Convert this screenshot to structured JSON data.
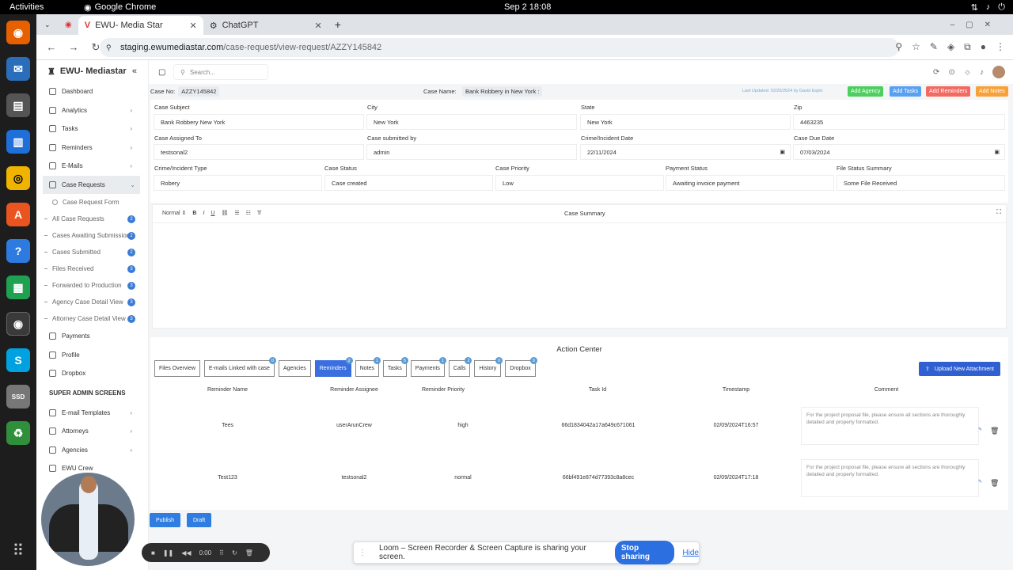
{
  "os": {
    "activities": "Activities",
    "app_name": "Google Chrome",
    "clock": "Sep 2  18:08"
  },
  "browser": {
    "tab1": "EWU- Media Star",
    "tab2": "ChatGPT",
    "url_host": "staging.ewumediastar.com",
    "url_path": "/case-request/view-request/AZZY145842"
  },
  "sidebar": {
    "brand": "EWU- Mediastar",
    "items": [
      "Dashboard",
      "Analytics",
      "Tasks",
      "Reminders",
      "E-Mails",
      "Case Requests"
    ],
    "form_item": "Case Request Form",
    "subs": [
      {
        "label": "All Case Requests",
        "count": "2"
      },
      {
        "label": "Cases Awaiting Submission",
        "count": "2"
      },
      {
        "label": "Cases Submitted",
        "count": "2"
      },
      {
        "label": "Files Received",
        "count": "3"
      },
      {
        "label": "Forwarded to Production",
        "count": "3"
      },
      {
        "label": "Agency Case Detail View",
        "count": "3"
      },
      {
        "label": "Attorney Case Detail View",
        "count": "3"
      }
    ],
    "items2": [
      "Payments",
      "Profile",
      "Dropbox"
    ],
    "section": "SUPER ADMIN SCREENS",
    "items3": [
      "E-mail Templates",
      "Attorneys",
      "Agencies",
      "EWU Crew"
    ]
  },
  "header": {
    "search_placeholder": "Search..."
  },
  "case": {
    "no_label": "Case No:",
    "no": "AZZY145842",
    "name_label": "Case Name:",
    "name": "Bank Robbery in New York :",
    "last_updated": "Last Updated: 02/25/2024 by David Espin"
  },
  "actions": {
    "add_agency": "Add Agency",
    "add_tasks": "Add Tasks",
    "add_reminders": "Add Reminders",
    "add_notes": "Add Notes"
  },
  "form": {
    "case_subject_label": "Case Subject",
    "case_subject": "Bank Robbery New York",
    "city_label": "City",
    "city": "New York",
    "state_label": "State",
    "state": "New York",
    "zip_label": "Zip",
    "zip": "4463235",
    "assigned_label": "Case Assigned To",
    "assigned": "testsonal2",
    "submitted_by_label": "Case submitted by",
    "submitted_by": "admin",
    "incident_date_label": "Crime/Incident Date",
    "incident_date": "22/11/2024",
    "due_date_label": "Case Due Date",
    "due_date": "07/03/2024",
    "incident_type_label": "Crime/Incident Type",
    "incident_type": "Robery",
    "status_label": "Case Status",
    "status": "Case created",
    "priority_label": "Case Priority",
    "priority": "Low",
    "payment_label": "Payment Status",
    "payment": "Awaiting invoice payment",
    "file_status_label": "File Status Summary",
    "file_status": "Some File Received"
  },
  "editor": {
    "format": "Normal",
    "title": "Case Summary"
  },
  "action_center": {
    "title": "Action Center",
    "upload": "Upload New Attachment",
    "tabs": [
      {
        "label": "Files Overview",
        "count": ""
      },
      {
        "label": "E-mails Linked with case",
        "count": "0"
      },
      {
        "label": "Agencies",
        "count": ""
      },
      {
        "label": "Reminders",
        "count": "2"
      },
      {
        "label": "Notes",
        "count": "1"
      },
      {
        "label": "Tasks",
        "count": "5"
      },
      {
        "label": "Payments",
        "count": "1"
      },
      {
        "label": "Calls",
        "count": "2"
      },
      {
        "label": "History",
        "count": "0"
      },
      {
        "label": "Dropbox",
        "count": "9"
      }
    ],
    "columns": [
      "Reminder Name",
      "Reminder Assignee",
      "Reminder Priority",
      "Task Id",
      "Timestamp",
      "Comment"
    ],
    "rows": [
      {
        "name": "Tees",
        "assignee": "userArunCrew",
        "priority": "high",
        "task_id": "66d1834042a17a649c671061",
        "timestamp": "02/09/2024T16:57",
        "comment": "For the project proposal file, please ensure all sections are thoroughly detailed and properly formatted."
      },
      {
        "name": "Test123",
        "assignee": "testsonal2",
        "priority": "normal",
        "task_id": "66bf491e874d77393c8a8cec",
        "timestamp": "02/09/2024T17:18",
        "comment": "For the project proposal file, please ensure all sections are thoroughly detailed and properly formatted."
      }
    ]
  },
  "buttons": {
    "publish": "Publish",
    "draft": "Draft"
  },
  "loom": {
    "text": "Loom – Screen Recorder & Screen Capture is sharing your screen.",
    "stop": "Stop sharing",
    "hide": "Hide"
  },
  "recorder": {
    "time": "0:00"
  }
}
